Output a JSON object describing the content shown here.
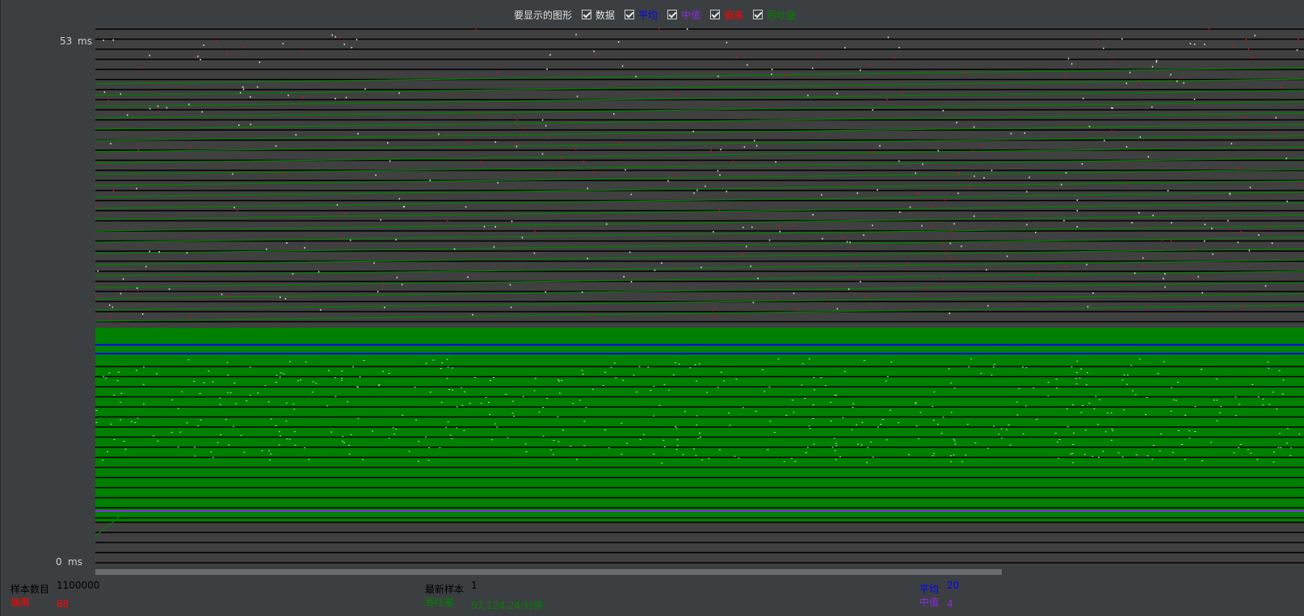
{
  "legend": {
    "title": "要显示的图形",
    "items": [
      {
        "label": "数据",
        "color": "#e0e0e0",
        "checked": true
      },
      {
        "label": "平均",
        "color": "#0000ff",
        "checked": true
      },
      {
        "label": "中值",
        "color": "#8a2be2",
        "checked": true
      },
      {
        "label": "偏离",
        "color": "#ff0000",
        "checked": true
      },
      {
        "label": "吞吐量",
        "color": "#008000",
        "checked": true
      }
    ]
  },
  "axis": {
    "y_max": "53",
    "y_min": "0",
    "unit": "ms"
  },
  "stats": {
    "samples_label": "样本数目",
    "samples_value": "1100000",
    "deviation_label": "偏离",
    "deviation_value": "88",
    "latest_label": "最新样本",
    "latest_value": "1",
    "throughput_label": "吞吐量",
    "throughput_value": "97,124.24/分钟",
    "average_label": "平均",
    "average_value": "20",
    "median_label": "中值",
    "median_value": "4"
  },
  "colors": {
    "background": "#3c3f41",
    "plot": "#404040",
    "data": "#000000",
    "average": "#0000ff",
    "median": "#8a2be2",
    "deviation": "#ff0000",
    "throughput": "#008000"
  },
  "chart_data": {
    "type": "line",
    "ylim": [
      0,
      53
    ],
    "ylabel": "ms",
    "grid": false,
    "series": [
      {
        "name": "平均",
        "values": [
          20
        ]
      },
      {
        "name": "中值",
        "values": [
          4
        ]
      },
      {
        "name": "偏离",
        "values": [
          88
        ]
      },
      {
        "name": "吞吐量",
        "values": [
          97124.24
        ]
      }
    ]
  }
}
